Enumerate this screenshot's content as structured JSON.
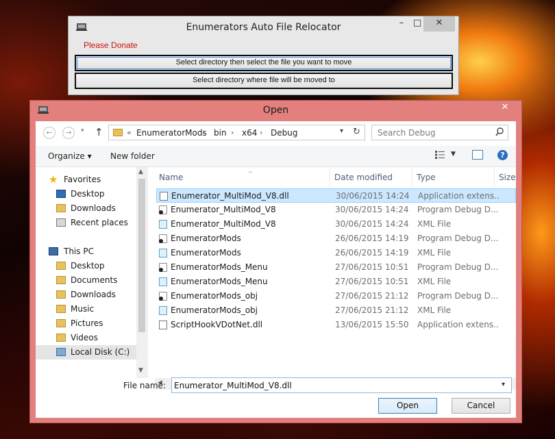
{
  "app": {
    "title": "Enumerators Auto File Relocator",
    "donate_label": "Please Donate",
    "select_file_button": "Select directory then select the file you want to move",
    "select_dest_button": "Select directory where file will be moved to",
    "controls": {
      "minimize": "–",
      "maximize": "□",
      "close": "✕"
    }
  },
  "dialog": {
    "title": "Open",
    "close": "✕",
    "nav": {
      "back": "←",
      "forward": "→",
      "recent": "▾",
      "up": "↑",
      "breadcrumb_prefix": "«",
      "breadcrumbs": [
        "EnumeratorMods",
        "bin",
        "x64",
        "Debug"
      ],
      "breadcrumb_sep": "›",
      "dropdown": "▾",
      "refresh": "↻",
      "search_placeholder": "Search Debug"
    },
    "toolbar": {
      "organize": "Organize ▾",
      "new_folder": "New folder",
      "view_dropdown": "▼",
      "help": "?"
    },
    "nav_pane": {
      "favorites_label": "Favorites",
      "favorites": [
        "Desktop",
        "Downloads",
        "Recent places"
      ],
      "thispc_label": "This PC",
      "thispc": [
        "Desktop",
        "Documents",
        "Downloads",
        "Music",
        "Pictures",
        "Videos",
        "Local Disk (C:)"
      ],
      "arrow_up": "▲",
      "arrow_down": "▼"
    },
    "columns": {
      "name": "Name",
      "date": "Date modified",
      "type": "Type",
      "size": "Size",
      "sort_indicator": "^"
    },
    "files": [
      {
        "name": "Enumerator_MultiMod_V8.dll",
        "date": "30/06/2015 14:24",
        "type": "Application extens...",
        "icon": "dll"
      },
      {
        "name": "Enumerator_MultiMod_V8",
        "date": "30/06/2015 14:24",
        "type": "Program Debug D...",
        "icon": "pdb"
      },
      {
        "name": "Enumerator_MultiMod_V8",
        "date": "30/06/2015 14:24",
        "type": "XML File",
        "icon": "xml"
      },
      {
        "name": "EnumeratorMods",
        "date": "26/06/2015 14:19",
        "type": "Program Debug D...",
        "icon": "pdb"
      },
      {
        "name": "EnumeratorMods",
        "date": "26/06/2015 14:19",
        "type": "XML File",
        "icon": "xml"
      },
      {
        "name": "EnumeratorMods_Menu",
        "date": "27/06/2015 10:51",
        "type": "Program Debug D...",
        "icon": "pdb"
      },
      {
        "name": "EnumeratorMods_Menu",
        "date": "27/06/2015 10:51",
        "type": "XML File",
        "icon": "xml"
      },
      {
        "name": "EnumeratorMods_obj",
        "date": "27/06/2015 21:12",
        "type": "Program Debug D...",
        "icon": "pdb"
      },
      {
        "name": "EnumeratorMods_obj",
        "date": "27/06/2015 21:12",
        "type": "XML File",
        "icon": "xml"
      },
      {
        "name": "ScriptHookVDotNet.dll",
        "date": "13/06/2015 15:50",
        "type": "Application extens...",
        "icon": "dll"
      }
    ],
    "hscroll": {
      "left": "◀",
      "right": "▶"
    },
    "file_name_label": "File name:",
    "file_name_value": "Enumerator_MultiMod_V8.dll",
    "file_name_dropdown": "▾",
    "open_button": "Open",
    "cancel_button": "Cancel"
  }
}
